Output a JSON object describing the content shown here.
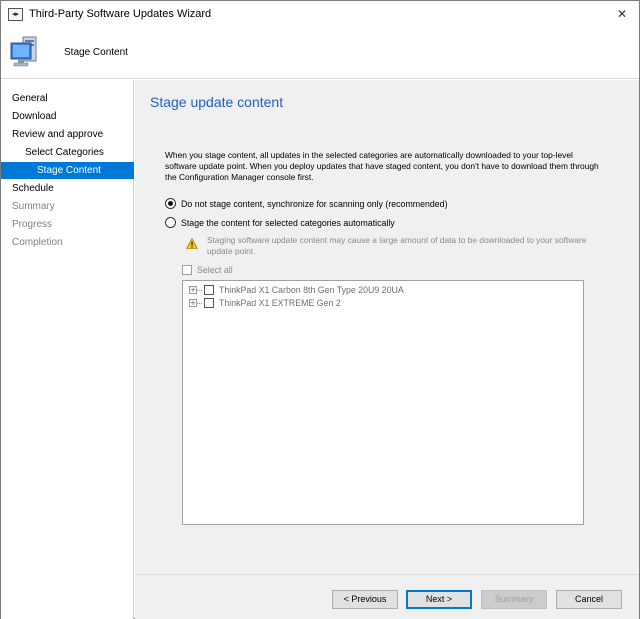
{
  "window": {
    "title": "Third-Party Software Updates Wizard",
    "close_glyph": "✕",
    "app_icon_glyph": "◂▸"
  },
  "header": {
    "title": "Stage Content",
    "icon": "computer-icon"
  },
  "nav": {
    "items": [
      {
        "label": "General",
        "state": "normal"
      },
      {
        "label": "Download",
        "state": "normal"
      },
      {
        "label": "Review and approve",
        "state": "normal"
      },
      {
        "label": "Select Categories",
        "state": "normal"
      },
      {
        "label": "Stage Content",
        "state": "active"
      },
      {
        "label": "Schedule",
        "state": "normal"
      },
      {
        "label": "Summary",
        "state": "dim"
      },
      {
        "label": "Progress",
        "state": "dim"
      },
      {
        "label": "Completion",
        "state": "dim"
      }
    ]
  },
  "main": {
    "heading": "Stage update content",
    "description": "When you stage content, all updates in the selected categories are automatically downloaded to your top-level software update point. When you deploy updates that have staged content, you don't have to download them through the Configuration Manager console first.",
    "options": [
      {
        "label": "Do not stage content, synchronize for scanning only (recommended)",
        "selected": true
      },
      {
        "label": "Stage the content for selected categories automatically",
        "selected": false
      }
    ],
    "warning": "Staging software update content may cause a large amount of data to be downloaded to your software update point.",
    "select_all_label": "Select all",
    "tree": [
      {
        "label": "ThinkPad X1 Carbon 8th Gen Type 20U9 20UA",
        "checked": false,
        "expander": "+"
      },
      {
        "label": "ThinkPad X1 EXTREME Gen 2",
        "checked": false,
        "expander": "+"
      }
    ]
  },
  "footer": {
    "previous_label": "< Previous",
    "next_label": "Next >",
    "summary_label": "Summary",
    "cancel_label": "Cancel"
  },
  "colors": {
    "accent": "#0078d7",
    "heading": "#1f5fbf",
    "panel_bg": "#f0f0f0"
  }
}
